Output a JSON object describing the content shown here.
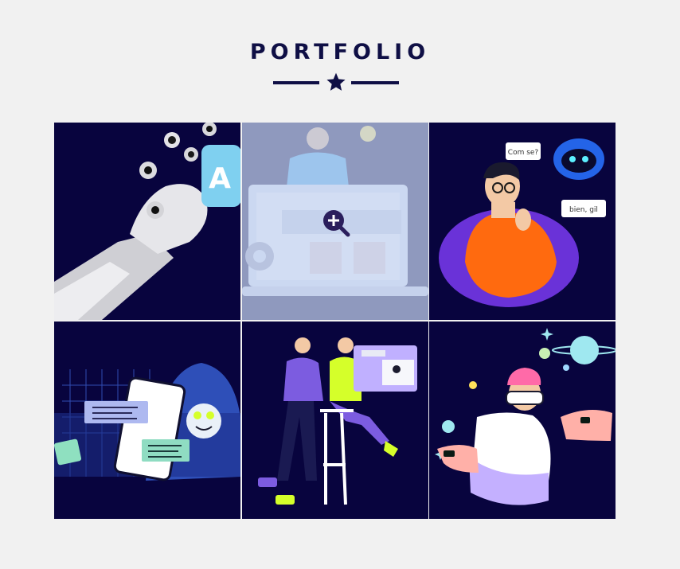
{
  "section": {
    "title": "PORTFOLIO",
    "divider_icon": "star-icon"
  },
  "colors": {
    "background": "#f1f1f1",
    "title": "#0f0f45",
    "tile_background": "#08043e",
    "hover_overlay": "#c4d2f0"
  },
  "gallery": {
    "items": [
      {
        "icon": "robot-hand-illustration",
        "hovered": false
      },
      {
        "icon": "laptop-idea-illustration",
        "hovered": true,
        "overlay_icon": "zoom-in-icon"
      },
      {
        "icon": "thinking-man-chatbot-illustration",
        "hovered": false,
        "bubbles": [
          "Com se?",
          "bien, gil"
        ]
      },
      {
        "icon": "phone-chat-illustration",
        "hovered": false
      },
      {
        "icon": "people-on-stools-illustration",
        "hovered": false
      },
      {
        "icon": "vr-space-illustration",
        "hovered": false
      }
    ]
  }
}
